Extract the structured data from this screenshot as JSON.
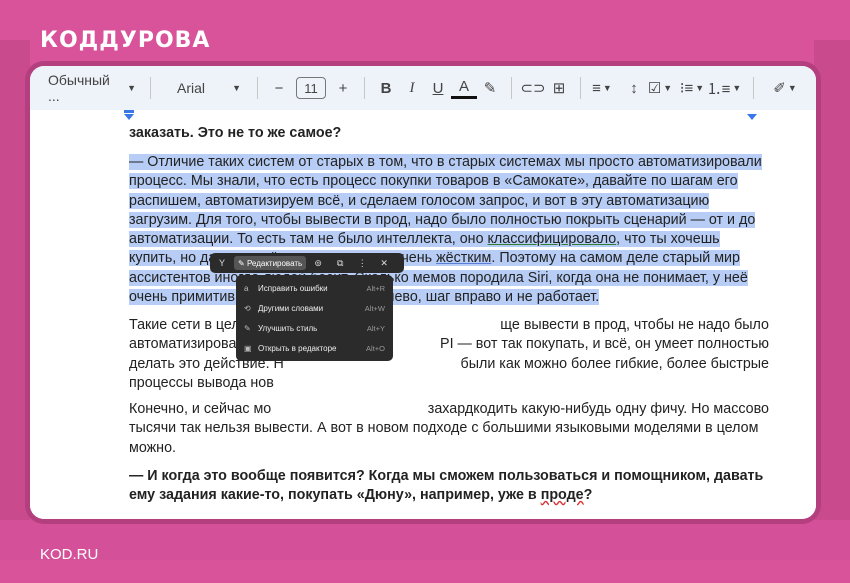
{
  "brand": {
    "logo": "КОДДУРОВА",
    "footer": "KOD.RU"
  },
  "toolbar": {
    "style": "Обычный ...",
    "font": "Arial",
    "size": "11",
    "icons": [
      "minus-icon",
      "plus-icon",
      "bold-icon",
      "italic-icon",
      "underline-icon",
      "text-color-icon",
      "highlight-icon",
      "link-icon",
      "comment-icon",
      "align-icon",
      "line-spacing-icon",
      "checklist-icon",
      "bullet-list-icon",
      "numbered-list-icon",
      "edit-mode-icon"
    ]
  },
  "doc": {
    "p0": "заказать. Это не то же самое?",
    "p1_a": "— Отличие таких систем от старых в том, что в старых системах мы просто автоматизировали процесс. Мы знали, что есть процесс покупки товаров в «Самокате», давайте по шагам его распишем, автоматизируем всё, и сделаем голосом запрос, и вот в эту автоматизацию загрузим. Для того, чтобы вывести в прод, надо было полностью покрыть сценарий — от и до автоматизации. То есть там не было интеллекта, оно ",
    "p1_u1": "классифицировало",
    "p1_b": ", что ты хочешь купить, но дальше всё шло по рельсам очень ",
    "p1_u2": "жёстким",
    "p1_c": ". Поэтому на самом деле старый мир ассистентов иногда людей бесит. Сколько мемов породила Siri, когда она не понимает, у неё очень примитивный сценарий — шаг влево, шаг вправо и не работает.",
    "p2_l1a": "Такие сети в целом",
    "p2_l1b": "ще вывести в прод, чтобы не надо было",
    "p2_l2a": "автоматизировать все",
    "p2_l2b": "PI — вот так покупать, и всё, он умеет полностью",
    "p2_l3a": "делать это действие. Н",
    "p2_l3b": "были как можно более гибкие, более быстрые",
    "p2_l4a": "процессы вывода нов",
    "p3_l1a": "Конечно, и сейчас мо",
    "p3_l1b": "захардкодить какую-нибудь одну фичу. Но массово",
    "p3_l2": "тысячи так нельзя вывести. А вот в новом подходе с большими языковыми моделями в целом",
    "p3_l3": "можно.",
    "p4_a": "— И когда это вообще появится? Когда мы сможем пользоваться и помощником, давать ему задания какие-то, покупать «Дюну», например, уже в ",
    "p4_u": "проде",
    "p4_b": "?"
  },
  "popup": {
    "edit_label": "Редактировать",
    "items": [
      {
        "icon": "a",
        "label": "Исправить ошибки",
        "key": "Alt+R"
      },
      {
        "icon": "⟲",
        "label": "Другими словами",
        "key": "Alt+W"
      },
      {
        "icon": "✎",
        "label": "Улучшить стиль",
        "key": "Alt+Y"
      },
      {
        "icon": "▣",
        "label": "Открыть в редакторе",
        "key": "Alt+O"
      }
    ]
  }
}
